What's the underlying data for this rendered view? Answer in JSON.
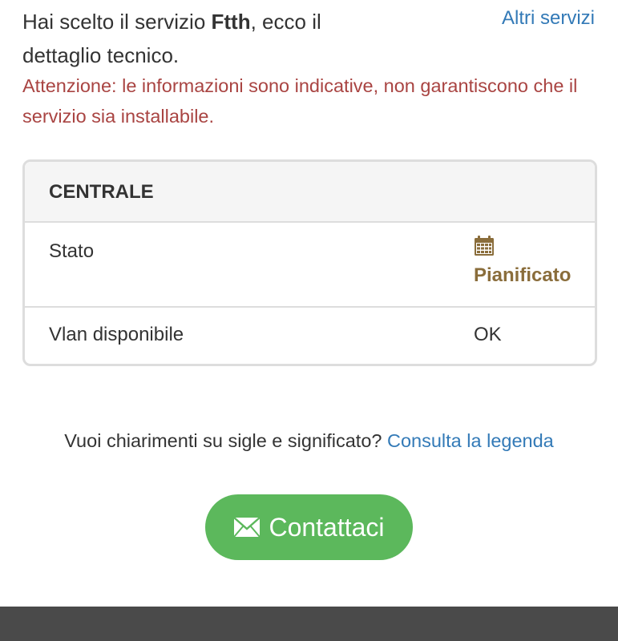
{
  "intro": {
    "text_before": "Hai scelto il servizio ",
    "service_name": "Ftth",
    "text_after": ", ecco il dettaglio tecnico."
  },
  "links": {
    "other_services": "Altri servizi"
  },
  "warning": {
    "text": "Attenzione: le informazioni sono indicative, non garantiscono che il servizio sia installabile."
  },
  "panel": {
    "heading": "CENTRALE",
    "rows": [
      {
        "label": "Stato",
        "value": "Pianificato",
        "icon": "calendar-icon"
      },
      {
        "label": "Vlan disponibile",
        "value": "OK"
      }
    ]
  },
  "legend": {
    "question": "Vuoi chiarimenti su sigle e significato?",
    "link": "Consulta la legenda"
  },
  "contact": {
    "label": "Contattaci",
    "icon": "envelope-icon"
  },
  "colors": {
    "link": "#337ab7",
    "warning": "#a94442",
    "status_planned": "#8a6d3b",
    "button_green": "#5cb85c",
    "footer": "#4a4a4a"
  }
}
